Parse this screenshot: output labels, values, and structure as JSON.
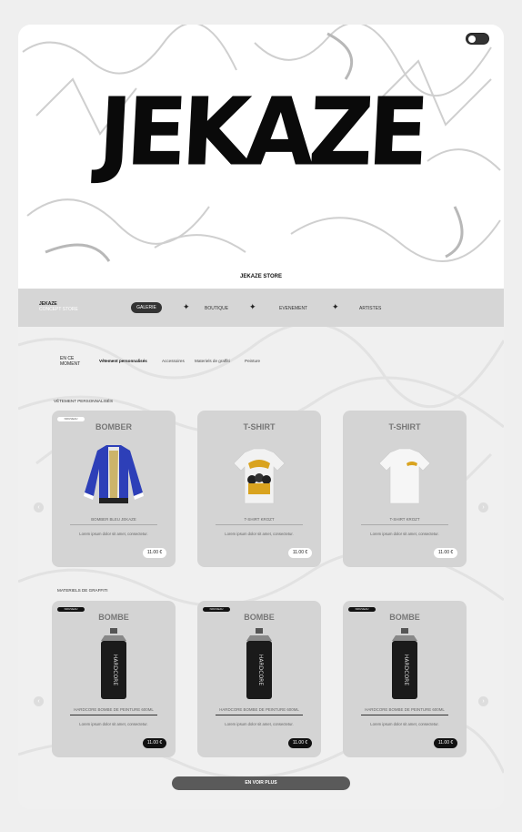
{
  "hero": {
    "logo_text": "JEKAZE",
    "store_title": "JEKAZE STORE",
    "toggle_icon": "theme-toggle"
  },
  "nav": {
    "brand_name": "JEKAZE",
    "brand_sub": "CONCEPT STORE",
    "items": [
      "GALERIE",
      "BOUTIQUE",
      "EVENEMENT",
      "ARTISTES"
    ],
    "separator_icon": "sparkle-icon"
  },
  "tabs": {
    "now_label": "EN CE MOMENT",
    "items": [
      "Vêtement personnalisés",
      "Accessoires",
      "Materiels de graffiti",
      "Peinture"
    ]
  },
  "section1": {
    "title": "VÊTEMENT PERSONNALISÉS",
    "cards": [
      {
        "badge": "NOUVEAU",
        "title": "BOMBER",
        "name": "BOMBER BLEU JEKAZE",
        "desc": "Lorem ipsum dolor sit amet, consectetur.",
        "price": "11.00 €",
        "image": "bomber-jacket"
      },
      {
        "badge": "",
        "title": "T-SHIRT",
        "name": "T-SHIRT KROZT",
        "desc": "Lorem ipsum dolor sit amet, consectetur.",
        "price": "11.00 €",
        "image": "tshirt-print"
      },
      {
        "badge": "",
        "title": "T-SHIRT",
        "name": "T-SHIRT KROZT",
        "desc": "Lorem ipsum dolor sit amet, consectetur.",
        "price": "11.00 €",
        "image": "tshirt-white"
      }
    ]
  },
  "section2": {
    "title": "MATERIELS DE GRAFFITI",
    "cards": [
      {
        "badge": "NOUVEAU",
        "title": "BOMBE",
        "name": "HARDCORE BOMBE DE PEINTURE 600ML",
        "desc": "Lorem ipsum dolor sit amet, consectetur.",
        "price": "11.00 €",
        "image": "spray-can"
      },
      {
        "badge": "NOUVEAU",
        "title": "BOMBE",
        "name": "HARDCORE BOMBE DE PEINTURE 600ML",
        "desc": "Lorem ipsum dolor sit amet, consectetur.",
        "price": "11.00 €",
        "image": "spray-can"
      },
      {
        "badge": "NOUVEAU",
        "title": "BOMBE",
        "name": "HARDCORE BOMBE DE PEINTURE 600ML",
        "desc": "Lorem ipsum dolor sit amet, consectetur.",
        "price": "11.00 €",
        "image": "spray-can"
      }
    ]
  },
  "can_label": "HARDCORE",
  "more_button": "EN VOIR PLUS",
  "colors": {
    "accent": "#111111",
    "card_bg": "#d4d4d4",
    "nav_bg": "#d6d6d6",
    "button": "#5a5a5a"
  }
}
